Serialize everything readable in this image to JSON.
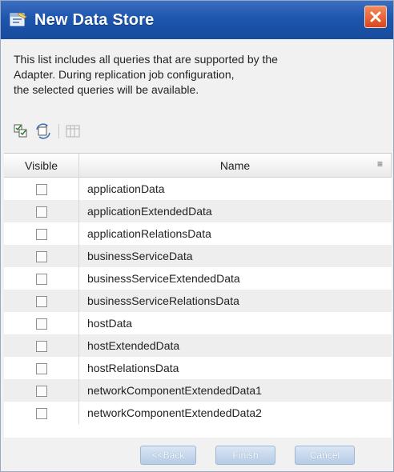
{
  "window": {
    "title": "New Data Store",
    "close_icon": "close-icon"
  },
  "description": {
    "line1": "This list includes all queries that are supported by the",
    "line2": "Adapter. During replication job configuration,",
    "line3": "the selected queries will be available."
  },
  "toolbar": {
    "icons": [
      "select-all-icon",
      "invert-selection-icon",
      "column-settings-icon"
    ]
  },
  "table": {
    "columns": [
      "Visible",
      "Name"
    ],
    "rows": [
      {
        "name": "applicationData",
        "visible": false
      },
      {
        "name": "applicationExtendedData",
        "visible": false
      },
      {
        "name": "applicationRelationsData",
        "visible": false
      },
      {
        "name": "businessServiceData",
        "visible": false
      },
      {
        "name": "businessServiceExtendedData",
        "visible": false
      },
      {
        "name": "businessServiceRelationsData",
        "visible": false
      },
      {
        "name": "hostData",
        "visible": false
      },
      {
        "name": "hostExtendedData",
        "visible": false
      },
      {
        "name": "hostRelationsData",
        "visible": false
      },
      {
        "name": "networkComponentExtendedData1",
        "visible": false
      },
      {
        "name": "networkComponentExtendedData2",
        "visible": false
      }
    ]
  },
  "buttons": {
    "back": "<<Back",
    "finish": "Finish",
    "cancel": "Cancel"
  }
}
